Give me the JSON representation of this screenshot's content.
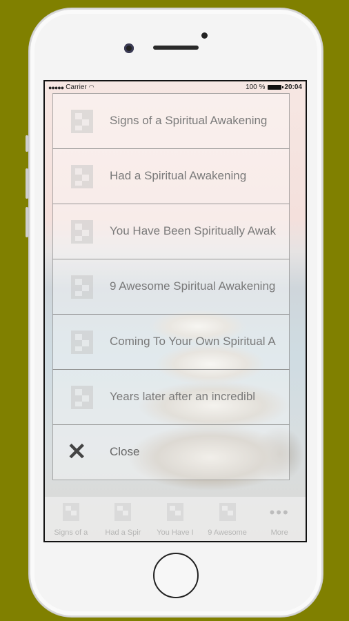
{
  "status_bar": {
    "carrier": "Carrier",
    "battery": "100 %",
    "time": "20:04"
  },
  "menu": {
    "items": [
      {
        "label": "Signs of a Spiritual Awakening",
        "icon": "article-thumb-icon"
      },
      {
        "label": "Had a Spiritual Awakening",
        "icon": "article-thumb-icon"
      },
      {
        "label": "You Have Been Spiritually Awak",
        "icon": "article-thumb-icon"
      },
      {
        "label": "9 Awesome Spiritual Awakening",
        "icon": "article-thumb-icon"
      },
      {
        "label": "Coming To Your Own Spiritual A",
        "icon": "article-thumb-icon"
      },
      {
        "label": "Years later after an incredibl",
        "icon": "article-thumb-icon"
      }
    ],
    "close_label": "Close"
  },
  "tabbar": {
    "tabs": [
      {
        "label": "Signs of a"
      },
      {
        "label": "Had a Spir"
      },
      {
        "label": "You Have I"
      },
      {
        "label": "9 Awesome"
      },
      {
        "label": "More"
      }
    ]
  },
  "colors": {
    "background": "#808000",
    "menu_text": "#7a7a7a"
  }
}
